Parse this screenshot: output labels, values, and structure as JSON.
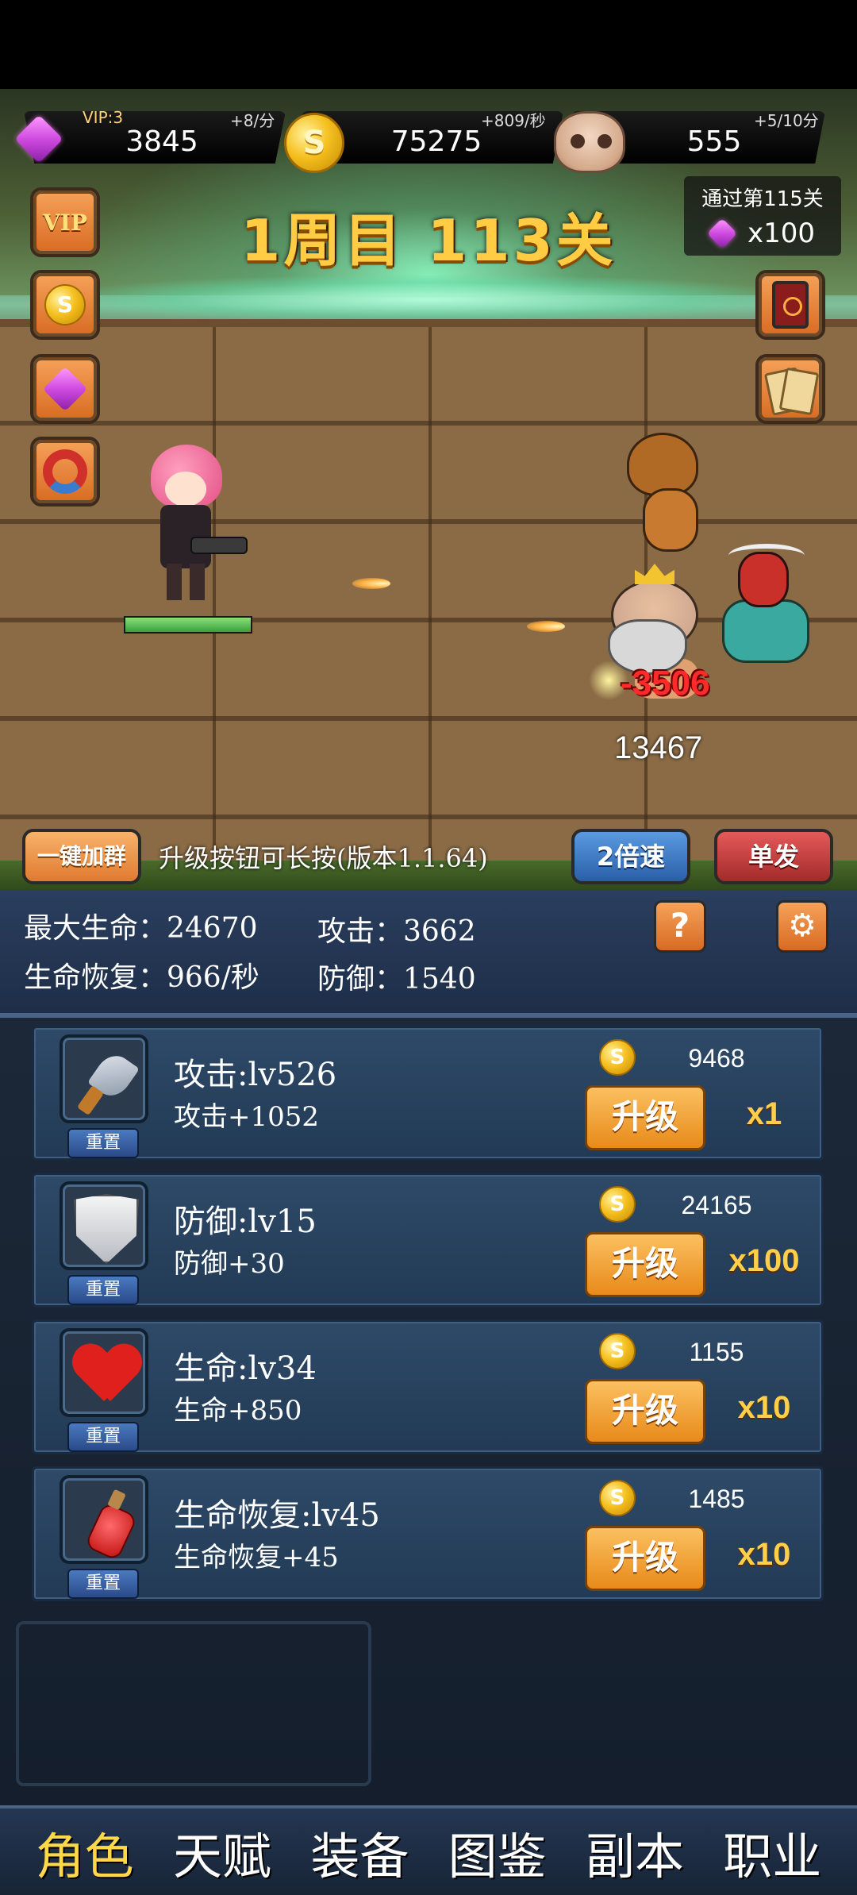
{
  "resources": {
    "vip_label": "VIP:3",
    "gems": "3845",
    "gem_rate": "+8/分",
    "gold": "75275",
    "gold_rate": "+809/秒",
    "skulls": "555",
    "skull_rate": "+5/10分"
  },
  "stage": {
    "title": "1周目 113关",
    "reward_title": "通过第115关",
    "reward_count": "x100"
  },
  "side_buttons": {
    "vip": "VIP",
    "coin": "S"
  },
  "battle": {
    "damage": "-3506",
    "enemy_hp": "13467",
    "hero_hp_fraction": 1.0
  },
  "controls": {
    "join_group": "一键加群",
    "notice": "升级按钮可长按(版本1.1.64)",
    "speed": "2倍速",
    "single": "单发"
  },
  "stats": {
    "max_hp": "最大生命：24670",
    "attack": "攻击：3662",
    "regen": "生命恢复：966/秒",
    "defense": "防御：1540",
    "help": "?"
  },
  "upgrades": [
    {
      "name": "攻击:lv526",
      "bonus": "攻击+1052",
      "cost": "9468",
      "button": "升级",
      "multiplier": "x1",
      "reset": "重置",
      "icon": "knife-icon"
    },
    {
      "name": "防御:lv15",
      "bonus": "防御+30",
      "cost": "24165",
      "button": "升级",
      "multiplier": "x100",
      "reset": "重置",
      "icon": "shield-icon"
    },
    {
      "name": "生命:lv34",
      "bonus": "生命+850",
      "cost": "1155",
      "button": "升级",
      "multiplier": "x10",
      "reset": "重置",
      "icon": "heart-icon"
    },
    {
      "name": "生命恢复:lv45",
      "bonus": "生命恢复+45",
      "cost": "1485",
      "button": "升级",
      "multiplier": "x10",
      "reset": "重置",
      "icon": "potion-icon"
    }
  ],
  "nav": [
    "角色",
    "天赋",
    "装备",
    "图鉴",
    "副本",
    "职业"
  ],
  "colors": {
    "accent": "#ffcc44",
    "panel": "#2e4a68",
    "upgrade_button": "#e88a1a"
  }
}
